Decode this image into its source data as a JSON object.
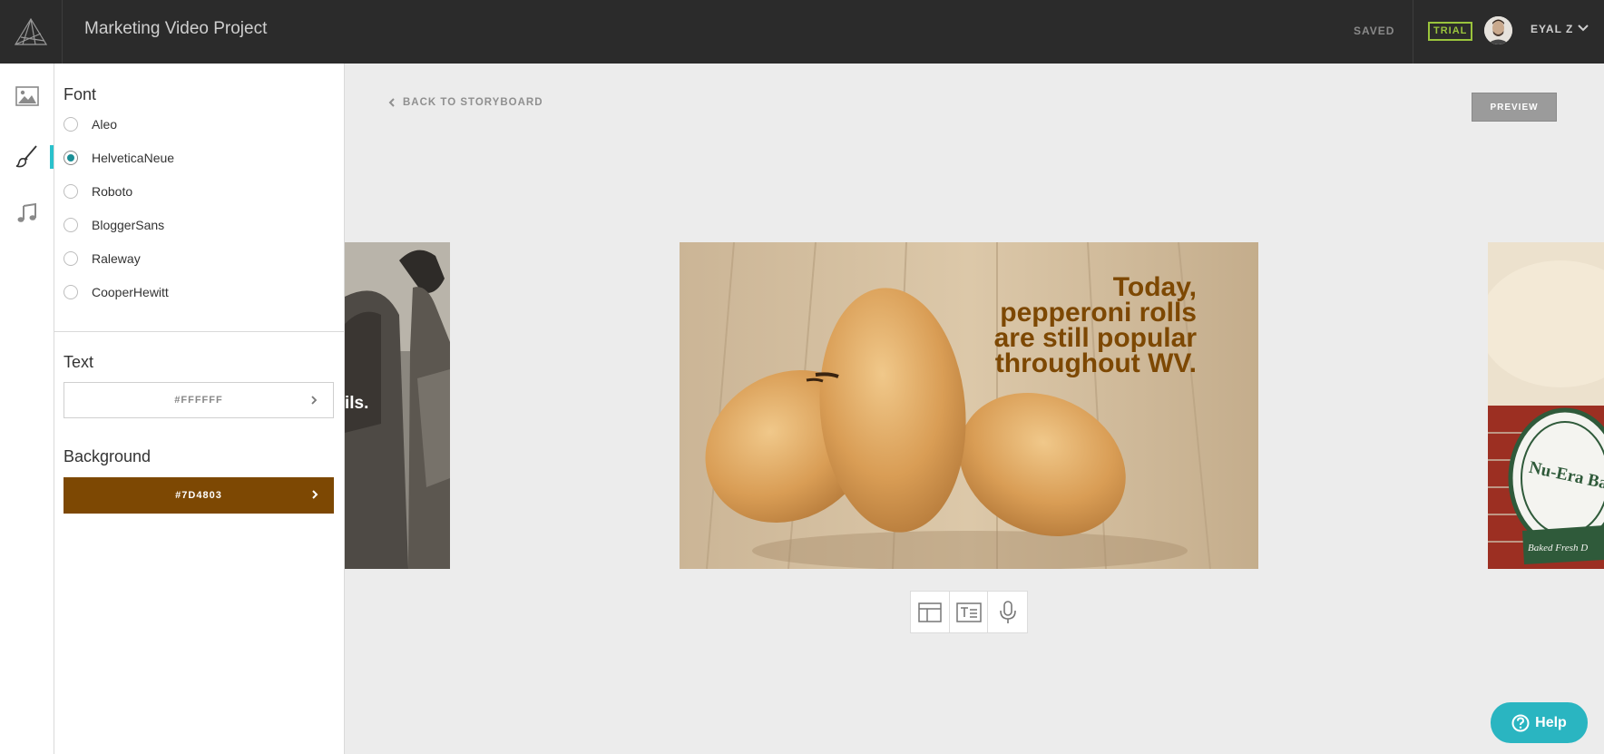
{
  "app": {
    "project_title": "Marketing Video Project",
    "save_status": "SAVED",
    "plan_badge": "TRIAL",
    "user_name": "EYAL Z"
  },
  "rail": {
    "items": [
      {
        "icon": "image-icon",
        "active": false
      },
      {
        "icon": "brush-icon",
        "active": true
      },
      {
        "icon": "music-icon",
        "active": false
      }
    ],
    "accent_color": "#2ac1cc"
  },
  "panel": {
    "font_title": "Font",
    "fonts": [
      {
        "label": "Aleo",
        "selected": false
      },
      {
        "label": "HelveticaNeue",
        "selected": true
      },
      {
        "label": "Roboto",
        "selected": false
      },
      {
        "label": "BloggerSans",
        "selected": false
      },
      {
        "label": "Raleway",
        "selected": false
      },
      {
        "label": "CooperHewitt",
        "selected": false
      }
    ],
    "text_title": "Text",
    "text_color": "#FFFFFF",
    "background_title": "Background",
    "background_color": "#7D4803"
  },
  "main": {
    "back_label": "BACK TO STORYBOARD",
    "preview_label": "PREVIEW",
    "prev_slide_text": "ils.",
    "current_slide_text": "Today,\npepperoni rolls\nare still popular\nthroughout WV.",
    "next_slide_sign_text": "Nu-Era Bakery",
    "next_slide_sign_sub": "Baked Fresh D",
    "tools": [
      {
        "icon": "layout-icon",
        "label": "Layout"
      },
      {
        "icon": "text-icon",
        "label": "Text"
      },
      {
        "icon": "microphone-icon",
        "label": "Voiceover"
      }
    ]
  },
  "help": {
    "label": "Help"
  }
}
